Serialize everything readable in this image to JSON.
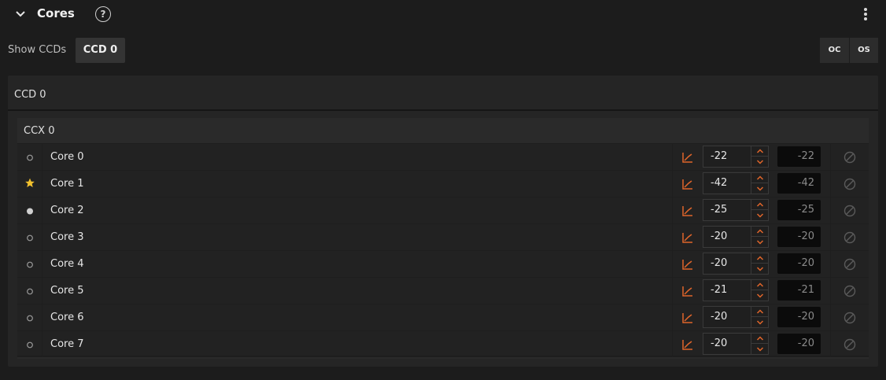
{
  "section": {
    "title": "Cores",
    "help_glyph": "?"
  },
  "toolbar": {
    "show_label": "Show CCDs",
    "ccd_button": "CCD 0",
    "oc_label": "OC",
    "os_label": "OS"
  },
  "ccd": {
    "title": "CCD 0",
    "ccx": {
      "title": "CCX 0",
      "cores": [
        {
          "name": "Core 0",
          "state": "empty-circle",
          "value": "-22",
          "readout": "-22"
        },
        {
          "name": "Core 1",
          "state": "star",
          "value": "-42",
          "readout": "-42"
        },
        {
          "name": "Core 2",
          "state": "filled-dot",
          "value": "-25",
          "readout": "-25"
        },
        {
          "name": "Core 3",
          "state": "empty-circle",
          "value": "-20",
          "readout": "-20"
        },
        {
          "name": "Core 4",
          "state": "empty-circle",
          "value": "-20",
          "readout": "-20"
        },
        {
          "name": "Core 5",
          "state": "empty-circle",
          "value": "-21",
          "readout": "-21"
        },
        {
          "name": "Core 6",
          "state": "empty-circle",
          "value": "-20",
          "readout": "-20"
        },
        {
          "name": "Core 7",
          "state": "empty-circle",
          "value": "-20",
          "readout": "-20"
        }
      ]
    }
  },
  "colors": {
    "accent": "#e0652a",
    "star": "#f2c12e",
    "background": "#1c1c1c"
  },
  "icons": {
    "collapse": "chevron-down-icon",
    "help": "help-circle-icon",
    "menu": "more-vertical-icon",
    "graph": "chart-icon",
    "reset": "disabled-icon"
  }
}
